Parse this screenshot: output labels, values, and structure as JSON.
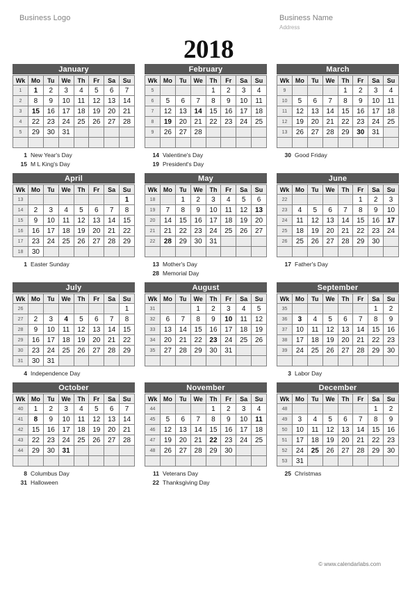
{
  "header": {
    "business_logo": "Business Logo",
    "business_name": "Business Name",
    "address": "Address"
  },
  "year": "2018",
  "weekday_headers": [
    "Wk",
    "Mo",
    "Tu",
    "We",
    "Th",
    "Fr",
    "Sa",
    "Su"
  ],
  "footer": "© www.calendarlabs.com",
  "colors": {
    "month_banner_bg": "#595959",
    "month_banner_text": "#ffffff",
    "header_row_bg": "#ebebeb",
    "empty_cell_bg": "#ebebeb",
    "grid_border": "#808080",
    "text": "#111111",
    "muted_text": "#808080"
  },
  "months": [
    {
      "name": "January",
      "weeks": [
        {
          "wk": "1",
          "days": [
            "1",
            "2",
            "3",
            "4",
            "5",
            "6",
            "7"
          ]
        },
        {
          "wk": "2",
          "days": [
            "8",
            "9",
            "10",
            "11",
            "12",
            "13",
            "14"
          ]
        },
        {
          "wk": "3",
          "days": [
            "15",
            "16",
            "17",
            "18",
            "19",
            "20",
            "21"
          ]
        },
        {
          "wk": "4",
          "days": [
            "22",
            "23",
            "24",
            "25",
            "26",
            "27",
            "28"
          ]
        },
        {
          "wk": "5",
          "days": [
            "29",
            "30",
            "31",
            "",
            "",
            "",
            ""
          ]
        },
        {
          "wk": "",
          "days": [
            "",
            "",
            "",
            "",
            "",
            "",
            ""
          ]
        }
      ],
      "holiday_days": [
        "1",
        "15"
      ],
      "notes": [
        {
          "day": "1",
          "label": "New Year's Day"
        },
        {
          "day": "15",
          "label": "M L King's Day"
        }
      ]
    },
    {
      "name": "February",
      "weeks": [
        {
          "wk": "5",
          "days": [
            "",
            "",
            "",
            "1",
            "2",
            "3",
            "4"
          ]
        },
        {
          "wk": "6",
          "days": [
            "5",
            "6",
            "7",
            "8",
            "9",
            "10",
            "11"
          ]
        },
        {
          "wk": "7",
          "days": [
            "12",
            "13",
            "14",
            "15",
            "16",
            "17",
            "18"
          ]
        },
        {
          "wk": "8",
          "days": [
            "19",
            "20",
            "21",
            "22",
            "23",
            "24",
            "25"
          ]
        },
        {
          "wk": "9",
          "days": [
            "26",
            "27",
            "28",
            "",
            "",
            "",
            ""
          ]
        },
        {
          "wk": "",
          "days": [
            "",
            "",
            "",
            "",
            "",
            "",
            ""
          ]
        }
      ],
      "holiday_days": [
        "14",
        "19"
      ],
      "notes": [
        {
          "day": "14",
          "label": "Valentine's Day"
        },
        {
          "day": "19",
          "label": "President's Day"
        }
      ]
    },
    {
      "name": "March",
      "weeks": [
        {
          "wk": "9",
          "days": [
            "",
            "",
            "",
            "1",
            "2",
            "3",
            "4"
          ]
        },
        {
          "wk": "10",
          "days": [
            "5",
            "6",
            "7",
            "8",
            "9",
            "10",
            "11"
          ]
        },
        {
          "wk": "11",
          "days": [
            "12",
            "13",
            "14",
            "15",
            "16",
            "17",
            "18"
          ]
        },
        {
          "wk": "12",
          "days": [
            "19",
            "20",
            "21",
            "22",
            "23",
            "24",
            "25"
          ]
        },
        {
          "wk": "13",
          "days": [
            "26",
            "27",
            "28",
            "29",
            "30",
            "31",
            ""
          ]
        },
        {
          "wk": "",
          "days": [
            "",
            "",
            "",
            "",
            "",
            "",
            ""
          ]
        }
      ],
      "holiday_days": [
        "30"
      ],
      "notes": [
        {
          "day": "30",
          "label": "Good Friday"
        }
      ]
    },
    {
      "name": "April",
      "weeks": [
        {
          "wk": "13",
          "days": [
            "",
            "",
            "",
            "",
            "",
            "",
            "1"
          ]
        },
        {
          "wk": "14",
          "days": [
            "2",
            "3",
            "4",
            "5",
            "6",
            "7",
            "8"
          ]
        },
        {
          "wk": "15",
          "days": [
            "9",
            "10",
            "11",
            "12",
            "13",
            "14",
            "15"
          ]
        },
        {
          "wk": "16",
          "days": [
            "16",
            "17",
            "18",
            "19",
            "20",
            "21",
            "22"
          ]
        },
        {
          "wk": "17",
          "days": [
            "23",
            "24",
            "25",
            "26",
            "27",
            "28",
            "29"
          ]
        },
        {
          "wk": "18",
          "days": [
            "30",
            "",
            "",
            "",
            "",
            "",
            ""
          ]
        }
      ],
      "holiday_days": [
        "1"
      ],
      "notes": [
        {
          "day": "1",
          "label": "Easter Sunday"
        }
      ]
    },
    {
      "name": "May",
      "weeks": [
        {
          "wk": "18",
          "days": [
            "",
            "1",
            "2",
            "3",
            "4",
            "5",
            "6"
          ]
        },
        {
          "wk": "19",
          "days": [
            "7",
            "8",
            "9",
            "10",
            "11",
            "12",
            "13"
          ]
        },
        {
          "wk": "20",
          "days": [
            "14",
            "15",
            "16",
            "17",
            "18",
            "19",
            "20"
          ]
        },
        {
          "wk": "21",
          "days": [
            "21",
            "22",
            "23",
            "24",
            "25",
            "26",
            "27"
          ]
        },
        {
          "wk": "22",
          "days": [
            "28",
            "29",
            "30",
            "31",
            "",
            "",
            ""
          ]
        },
        {
          "wk": "",
          "days": [
            "",
            "",
            "",
            "",
            "",
            "",
            ""
          ]
        }
      ],
      "holiday_days": [
        "13",
        "28"
      ],
      "notes": [
        {
          "day": "13",
          "label": "Mother's Day"
        },
        {
          "day": "28",
          "label": "Memorial Day"
        }
      ]
    },
    {
      "name": "June",
      "weeks": [
        {
          "wk": "22",
          "days": [
            "",
            "",
            "",
            "",
            "1",
            "2",
            "3"
          ]
        },
        {
          "wk": "23",
          "days": [
            "4",
            "5",
            "6",
            "7",
            "8",
            "9",
            "10"
          ]
        },
        {
          "wk": "24",
          "days": [
            "11",
            "12",
            "13",
            "14",
            "15",
            "16",
            "17"
          ]
        },
        {
          "wk": "25",
          "days": [
            "18",
            "19",
            "20",
            "21",
            "22",
            "23",
            "24"
          ]
        },
        {
          "wk": "26",
          "days": [
            "25",
            "26",
            "27",
            "28",
            "29",
            "30",
            ""
          ]
        },
        {
          "wk": "",
          "days": [
            "",
            "",
            "",
            "",
            "",
            "",
            ""
          ]
        }
      ],
      "holiday_days": [
        "17"
      ],
      "notes": [
        {
          "day": "17",
          "label": "Father's Day"
        }
      ]
    },
    {
      "name": "July",
      "weeks": [
        {
          "wk": "26",
          "days": [
            "",
            "",
            "",
            "",
            "",
            "",
            "1"
          ]
        },
        {
          "wk": "27",
          "days": [
            "2",
            "3",
            "4",
            "5",
            "6",
            "7",
            "8"
          ]
        },
        {
          "wk": "28",
          "days": [
            "9",
            "10",
            "11",
            "12",
            "13",
            "14",
            "15"
          ]
        },
        {
          "wk": "29",
          "days": [
            "16",
            "17",
            "18",
            "19",
            "20",
            "21",
            "22"
          ]
        },
        {
          "wk": "30",
          "days": [
            "23",
            "24",
            "25",
            "26",
            "27",
            "28",
            "29"
          ]
        },
        {
          "wk": "31",
          "days": [
            "30",
            "31",
            "",
            "",
            "",
            "",
            ""
          ]
        }
      ],
      "holiday_days": [
        "4"
      ],
      "notes": [
        {
          "day": "4",
          "label": "Independence Day"
        }
      ]
    },
    {
      "name": "August",
      "weeks": [
        {
          "wk": "31",
          "days": [
            "",
            "",
            "1",
            "2",
            "3",
            "4",
            "5"
          ]
        },
        {
          "wk": "32",
          "days": [
            "6",
            "7",
            "8",
            "9",
            "10",
            "11",
            "12"
          ]
        },
        {
          "wk": "33",
          "days": [
            "13",
            "14",
            "15",
            "16",
            "17",
            "18",
            "19"
          ]
        },
        {
          "wk": "34",
          "days": [
            "20",
            "21",
            "22",
            "23",
            "24",
            "25",
            "26"
          ]
        },
        {
          "wk": "35",
          "days": [
            "27",
            "28",
            "29",
            "30",
            "31",
            "",
            ""
          ]
        },
        {
          "wk": "",
          "days": [
            "",
            "",
            "",
            "",
            "",
            "",
            ""
          ]
        }
      ],
      "holiday_days": [
        "10",
        "23"
      ],
      "notes": []
    },
    {
      "name": "September",
      "weeks": [
        {
          "wk": "35",
          "days": [
            "",
            "",
            "",
            "",
            "",
            "1",
            "2"
          ]
        },
        {
          "wk": "36",
          "days": [
            "3",
            "4",
            "5",
            "6",
            "7",
            "8",
            "9"
          ]
        },
        {
          "wk": "37",
          "days": [
            "10",
            "11",
            "12",
            "13",
            "14",
            "15",
            "16"
          ]
        },
        {
          "wk": "38",
          "days": [
            "17",
            "18",
            "19",
            "20",
            "21",
            "22",
            "23"
          ]
        },
        {
          "wk": "39",
          "days": [
            "24",
            "25",
            "26",
            "27",
            "28",
            "29",
            "30"
          ]
        },
        {
          "wk": "",
          "days": [
            "",
            "",
            "",
            "",
            "",
            "",
            ""
          ]
        }
      ],
      "holiday_days": [
        "3"
      ],
      "notes": [
        {
          "day": "3",
          "label": "Labor Day"
        }
      ]
    },
    {
      "name": "October",
      "weeks": [
        {
          "wk": "40",
          "days": [
            "1",
            "2",
            "3",
            "4",
            "5",
            "6",
            "7"
          ]
        },
        {
          "wk": "41",
          "days": [
            "8",
            "9",
            "10",
            "11",
            "12",
            "13",
            "14"
          ]
        },
        {
          "wk": "42",
          "days": [
            "15",
            "16",
            "17",
            "18",
            "19",
            "20",
            "21"
          ]
        },
        {
          "wk": "43",
          "days": [
            "22",
            "23",
            "24",
            "25",
            "26",
            "27",
            "28"
          ]
        },
        {
          "wk": "44",
          "days": [
            "29",
            "30",
            "31",
            "",
            "",
            "",
            ""
          ]
        },
        {
          "wk": "",
          "days": [
            "",
            "",
            "",
            "",
            "",
            "",
            ""
          ]
        }
      ],
      "holiday_days": [
        "8",
        "31"
      ],
      "notes": [
        {
          "day": "8",
          "label": "Columbus Day"
        },
        {
          "day": "31",
          "label": "Halloween"
        }
      ]
    },
    {
      "name": "November",
      "weeks": [
        {
          "wk": "44",
          "days": [
            "",
            "",
            "",
            "1",
            "2",
            "3",
            "4"
          ]
        },
        {
          "wk": "45",
          "days": [
            "5",
            "6",
            "7",
            "8",
            "9",
            "10",
            "11"
          ]
        },
        {
          "wk": "46",
          "days": [
            "12",
            "13",
            "14",
            "15",
            "16",
            "17",
            "18"
          ]
        },
        {
          "wk": "47",
          "days": [
            "19",
            "20",
            "21",
            "22",
            "23",
            "24",
            "25"
          ]
        },
        {
          "wk": "48",
          "days": [
            "26",
            "27",
            "28",
            "29",
            "30",
            "",
            ""
          ]
        },
        {
          "wk": "",
          "days": [
            "",
            "",
            "",
            "",
            "",
            "",
            ""
          ]
        }
      ],
      "holiday_days": [
        "11",
        "22"
      ],
      "notes": [
        {
          "day": "11",
          "label": "Veterans Day"
        },
        {
          "day": "22",
          "label": "Thanksgiving Day"
        }
      ]
    },
    {
      "name": "December",
      "weeks": [
        {
          "wk": "48",
          "days": [
            "",
            "",
            "",
            "",
            "",
            "1",
            "2"
          ]
        },
        {
          "wk": "49",
          "days": [
            "3",
            "4",
            "5",
            "6",
            "7",
            "8",
            "9"
          ]
        },
        {
          "wk": "50",
          "days": [
            "10",
            "11",
            "12",
            "13",
            "14",
            "15",
            "16"
          ]
        },
        {
          "wk": "51",
          "days": [
            "17",
            "18",
            "19",
            "20",
            "21",
            "22",
            "23"
          ]
        },
        {
          "wk": "52",
          "days": [
            "24",
            "25",
            "26",
            "27",
            "28",
            "29",
            "30"
          ]
        },
        {
          "wk": "53",
          "days": [
            "31",
            "",
            "",
            "",
            "",
            "",
            ""
          ]
        }
      ],
      "holiday_days": [
        "25"
      ],
      "notes": [
        {
          "day": "25",
          "label": "Christmas"
        }
      ]
    }
  ]
}
